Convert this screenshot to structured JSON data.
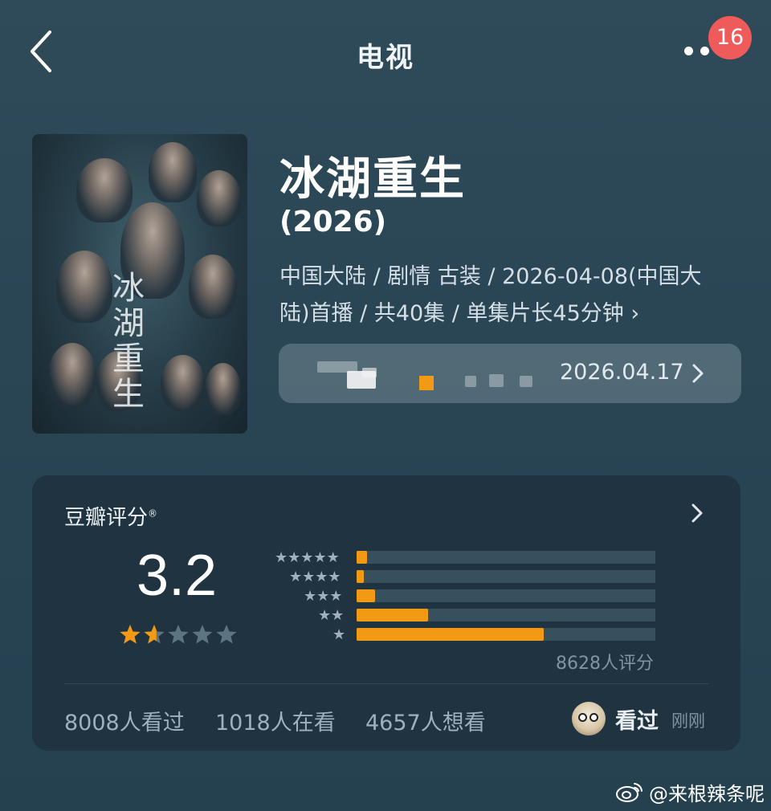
{
  "header": {
    "title": "电视",
    "back_icon": "chevron-left-icon",
    "more_icon": "more-dots-icon",
    "notification_count": "16"
  },
  "show": {
    "name": "冰湖重生",
    "year": "(2026)",
    "meta_line1": "中国大陆 / 剧情 古装 / 2026-04-08(中国大",
    "meta_line2": "陆)首播 / 共40集 / 单集片长45分钟 ›",
    "poster_calligraphy": "冰湖重生"
  },
  "schedule": {
    "date": "2026.04.17"
  },
  "rating": {
    "title": "豆瓣评分",
    "registered": "®",
    "score": "3.2",
    "star_fill_fraction": 0.32,
    "distribution": [
      {
        "stars": 5,
        "value": 0.036
      },
      {
        "stars": 4,
        "value": 0.024
      },
      {
        "stars": 3,
        "value": 0.063
      },
      {
        "stars": 2,
        "value": 0.24
      },
      {
        "stars": 1,
        "value": 0.625
      }
    ],
    "raters": "8628人评分"
  },
  "stats": {
    "watched": "8008人看过",
    "watching": "1018人在看",
    "want": "4657人想看"
  },
  "user": {
    "status": "看过",
    "time": "刚刚"
  },
  "watermark": {
    "text": "@来根辣条呢"
  },
  "colors": {
    "accent_orange": "#f39a14",
    "badge_red": "#ef5a5a",
    "card_bg": "#1f3340"
  }
}
